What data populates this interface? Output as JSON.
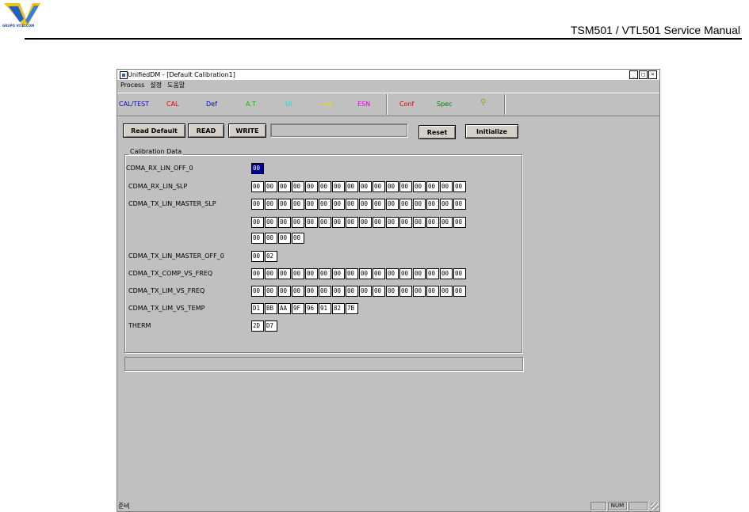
{
  "manual": {
    "logo_text": "GRUPO VITELCOM",
    "title": "TSM501 / VTL501 Service Manual"
  },
  "window": {
    "title": "UnifiedDM - [Default Calibration1]",
    "controls": [
      "_",
      "□",
      "×"
    ]
  },
  "menu": [
    "Process",
    "설정",
    "도움말"
  ],
  "toolbar": [
    {
      "label": "CAL/TEST",
      "color": "#1010a0"
    },
    {
      "label": "CAL",
      "color": "#e00000"
    },
    {
      "label": "Def",
      "color": "#0000d0"
    },
    {
      "label": "A.T",
      "color": "#00c000"
    },
    {
      "label": "UI",
      "color": "#00e0e0"
    },
    {
      "label": "mA",
      "color": "#e0e000"
    },
    {
      "label": "ESN",
      "color": "#e000e0"
    },
    {
      "label": "Conf",
      "color": "#e00000"
    },
    {
      "label": "Spec",
      "color": "#008000"
    }
  ],
  "toolbar_help_icon": "help-lightbulb-icon",
  "buttons": {
    "read_default": "Read Default",
    "read": "READ",
    "write": "WRITE",
    "reset": "Reset",
    "initialize": "Initialize"
  },
  "group_title": "Calibration Data",
  "rows": [
    {
      "label": "CDMA_RX_LIN_OFF_0",
      "cells": [
        "00"
      ]
    },
    {
      "label": "CDMA_RX_LIN_SLP",
      "cells": [
        "00",
        "00",
        "00",
        "00",
        "00",
        "00",
        "00",
        "00",
        "00",
        "00",
        "00",
        "00",
        "00",
        "00",
        "00",
        "00"
      ]
    },
    {
      "label": "CDMA_TX_LIN_MASTER_SLP",
      "cells": [
        "00",
        "00",
        "00",
        "00",
        "00",
        "00",
        "00",
        "00",
        "00",
        "00",
        "00",
        "00",
        "00",
        "00",
        "00",
        "00"
      ]
    },
    {
      "label": "",
      "cells": [
        "00",
        "00",
        "00",
        "00",
        "00",
        "00",
        "00",
        "00",
        "00",
        "00",
        "00",
        "00",
        "00",
        "00",
        "00",
        "00"
      ]
    },
    {
      "label": "",
      "cells": [
        "00",
        "00",
        "00",
        "00"
      ]
    },
    {
      "label": "CDMA_TX_LIN_MASTER_OFF_0",
      "cells": [
        "00",
        "02"
      ]
    },
    {
      "label": "CDMA_TX_COMP_VS_FREQ",
      "cells": [
        "00",
        "00",
        "00",
        "00",
        "00",
        "00",
        "00",
        "00",
        "00",
        "00",
        "00",
        "00",
        "00",
        "00",
        "00",
        "00"
      ]
    },
    {
      "label": "CDMA_TX_LIM_VS_FREQ",
      "cells": [
        "00",
        "00",
        "00",
        "00",
        "00",
        "00",
        "00",
        "00",
        "00",
        "00",
        "00",
        "00",
        "00",
        "00",
        "00",
        "00"
      ]
    },
    {
      "label": "CDMA_TX_LIM_VS_TEMP",
      "cells": [
        "D1",
        "BB",
        "AA",
        "9F",
        "96",
        "91",
        "82",
        "7B"
      ]
    },
    {
      "label": "THERM",
      "cells": [
        "2D",
        "D7"
      ]
    }
  ],
  "status": {
    "text": "준비",
    "num": "NUM"
  }
}
